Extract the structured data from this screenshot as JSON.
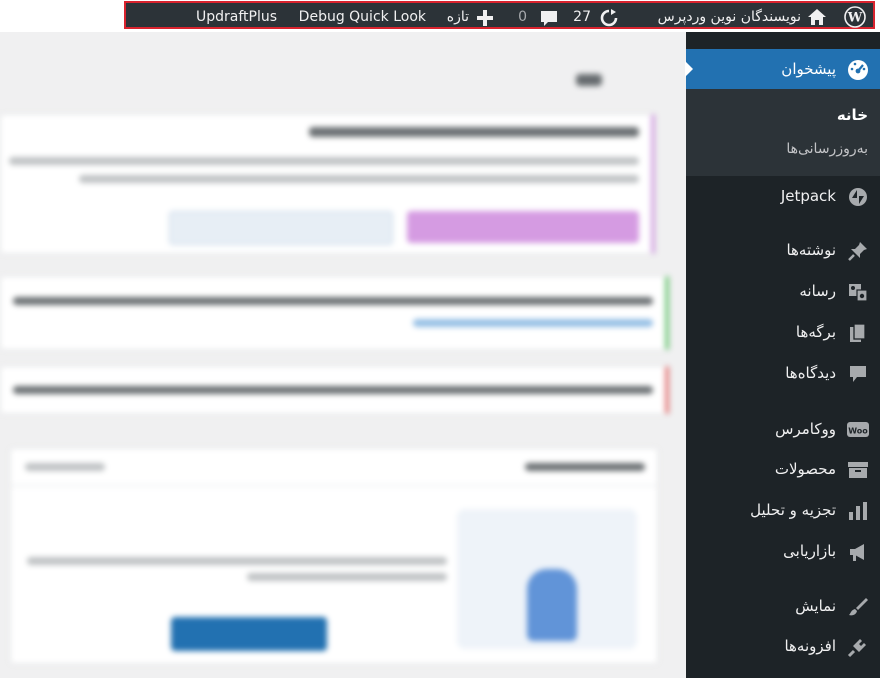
{
  "adminbar": {
    "site_name": "نویسندگان نوین وردپرس",
    "updates_count": "27",
    "comments_count": "0",
    "new_label": "تازه",
    "debug_label": "Debug Quick Look",
    "updraft_label": "UpdraftPlus",
    "highlight_color": "#d9232e"
  },
  "sidebar": {
    "dashboard": "پیشخوان",
    "submenu": {
      "home": "خانه",
      "updates": "به‌روزرسانی‌ها"
    },
    "items": [
      {
        "label": "Jetpack",
        "icon": "jetpack-icon"
      },
      {
        "label": "نوشته‌ها",
        "icon": "pin-icon"
      },
      {
        "label": "رسانه",
        "icon": "media-icon"
      },
      {
        "label": "برگه‌ها",
        "icon": "pages-icon"
      },
      {
        "label": "دیدگاه‌ها",
        "icon": "comment-icon"
      },
      {
        "label": "ووکامرس",
        "icon": "woo-icon"
      },
      {
        "label": "محصولات",
        "icon": "archive-icon"
      },
      {
        "label": "تجزیه و تحلیل",
        "icon": "chart-icon"
      },
      {
        "label": "بازاریابی",
        "icon": "megaphone-icon"
      },
      {
        "label": "نمایش",
        "icon": "brush-icon"
      },
      {
        "label": "افزونه‌ها",
        "icon": "plugin-icon"
      }
    ],
    "accent_color": "#2271b1"
  }
}
